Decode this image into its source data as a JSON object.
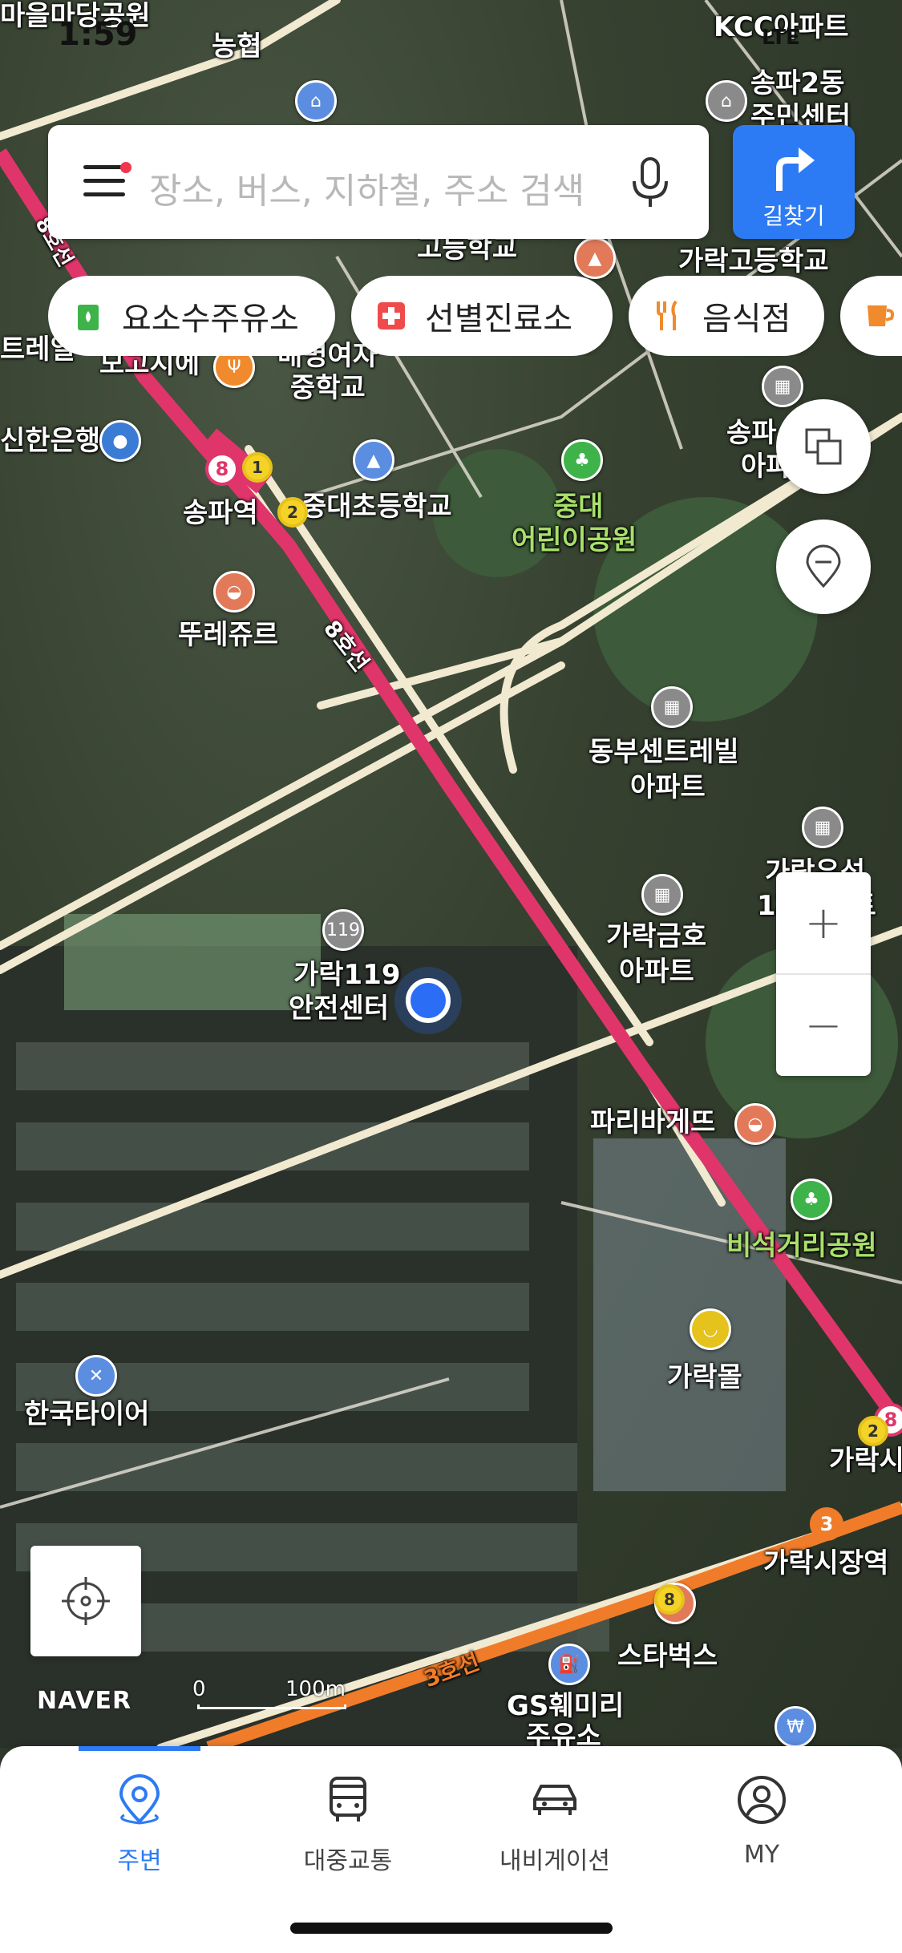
{
  "status_bar": {
    "time": "1:59",
    "network": "LTE"
  },
  "search": {
    "placeholder": "장소, 버스, 지하철, 주소 검색"
  },
  "route_button": {
    "label": "길찾기"
  },
  "chips": [
    {
      "label": "요소수주유소",
      "icon": "fuel-icon",
      "color": "#3db34a"
    },
    {
      "label": "선별진료소",
      "icon": "medical-cross-icon",
      "color": "#ef4b4b"
    },
    {
      "label": "음식점",
      "icon": "fork-knife-icon",
      "color": "#f08a2c"
    },
    {
      "label": "",
      "icon": "cafe-cup-icon",
      "color": "#f08a2c"
    }
  ],
  "map_labels": {
    "park_top": "마을마당공원",
    "nonghyup": "농협",
    "kcc_apt": "KCC아파트",
    "songpa2dong": "송파2동",
    "community_center": "주민센터",
    "high_school": "고등학교",
    "garak_high": "가락고등학교",
    "terrace": "트레일",
    "mogoji": "모고지에",
    "girls_middle_1": "배명여자",
    "girls_middle_2": "중학교",
    "shinhan": "신한은행",
    "songpa_station": "송파역",
    "elementary": "중대초등학교",
    "joongdae_park_1": "중대",
    "joongdae_park_2": "어린이공원",
    "songpa_apt_1": "송파",
    "songpa_apt_2": "아파",
    "touslesjours": "뚜레쥬르",
    "line8_top": "8호선",
    "line8_mid": "8호선",
    "dongbu_1": "동부센트레빌",
    "dongbu_2": "아파트",
    "garak_ossin_1": "가락우성",
    "garak_ossin_2": "1차아파트",
    "garak119_1": "가락119",
    "garak119_2": "안전센터",
    "geumho_1": "가락금호",
    "geumho_2": "아파트",
    "paris": "파리바게뜨",
    "biseok_park": "비석거리공원",
    "garak_mall": "가락몰",
    "garak_st": "가락시",
    "hankook_tire": "한국타이어",
    "garak_market_station": "가락시장역",
    "starbucks": "스타벅스",
    "line3": "3호선",
    "gs_1": "GS훼미리",
    "gs_2": "주유소"
  },
  "scale": {
    "zero": "0",
    "distance": "100m"
  },
  "brand": "NAVER",
  "tabs": [
    {
      "label": "주변",
      "icon": "location-pin-icon",
      "active": true
    },
    {
      "label": "대중교통",
      "icon": "bus-icon",
      "active": false
    },
    {
      "label": "내비게이션",
      "icon": "car-icon",
      "active": false
    },
    {
      "label": "MY",
      "icon": "profile-icon",
      "active": false
    }
  ],
  "colors": {
    "accent": "#2d7bf4",
    "line8": "#e0356b",
    "line3": "#f07c2a",
    "line1": "#e6c21c"
  }
}
